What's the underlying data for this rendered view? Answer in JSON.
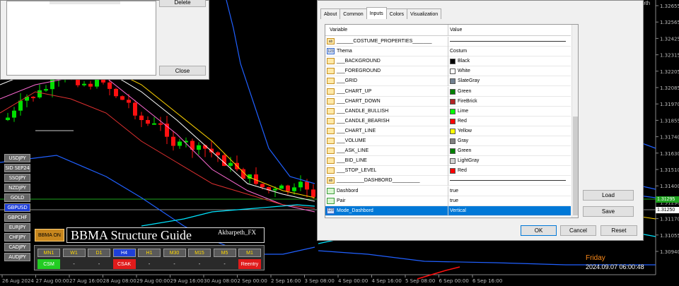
{
  "left_dialog": {
    "delete_label": "Delete",
    "close_label": "Close"
  },
  "price_axis": {
    "labels": [
      "1.32655",
      "1.32565",
      "1.32425",
      "1.32315",
      "1.32205",
      "1.32085",
      "1.31970",
      "1.31855",
      "1.31740",
      "1.31630",
      "1.31510",
      "1.31400",
      "1.31290",
      "1.31170",
      "1.31055",
      "1.30940"
    ],
    "current_green": "1.31295",
    "current_white": "1.31250"
  },
  "time_axis": {
    "labels": [
      "26 Aug 2024",
      "27 Aug 00:00",
      "27 Aug 16:00",
      "28 Aug 08:00",
      "29 Aug 00:00",
      "29 Aug 16:00",
      "30 Aug 08:00",
      "2 Sep 00:00",
      "2 Sep 16:00",
      "3 Sep 08:00",
      "4 Sep 00:00",
      "4 Sep 16:00",
      "5 Sep 08:00",
      "6 Sep 00:00",
      "6 Sep 16:00"
    ]
  },
  "symbols": [
    "USDJPY",
    "SID SEP24",
    "SSOJPY",
    "NZDJPY",
    "GOLD",
    "GBPUSD",
    "GBPCHF",
    "EURJPY",
    "CHFJPY",
    "CADJPY",
    "AUDJPY"
  ],
  "active_symbol": "GBPUSD",
  "dashboard": {
    "bbma_on": "BBMA ON",
    "title": "BBMA Structure Guide",
    "author": "Akbarpeth_FX",
    "timeframes": [
      "MN1",
      "W1",
      "D1",
      "H4",
      "H1",
      "M30",
      "M15",
      "M5",
      "M1"
    ],
    "active_tf": "H4",
    "signals": [
      {
        "text": "CSM",
        "color": "#22cc22"
      },
      {
        "text": "-",
        "color": ""
      },
      {
        "text": "-",
        "color": ""
      },
      {
        "text": "CSAK",
        "color": "#e01b1b"
      },
      {
        "text": "-",
        "color": ""
      },
      {
        "text": "-",
        "color": ""
      },
      {
        "text": "-",
        "color": ""
      },
      {
        "text": "-",
        "color": ""
      },
      {
        "text": "Reentry",
        "color": "#e01b1b"
      }
    ]
  },
  "clock": {
    "day": "Friday",
    "datetime": "2024.09.07 06:00:48"
  },
  "corner_text": "eth",
  "props_dialog": {
    "tabs": [
      "About",
      "Common",
      "Inputs",
      "Colors",
      "Visualization"
    ],
    "active_tab": "Inputs",
    "col_variable": "Variable",
    "col_value": "Value",
    "rows": [
      {
        "icon": "ab",
        "name": "______COSTUME_PROPERTIES_______",
        "value": "",
        "kind": "line"
      },
      {
        "icon": "123",
        "name": "Thema",
        "value": "Costum",
        "kind": "text"
      },
      {
        "icon": "clr",
        "name": "___BACKGROUND",
        "value": "Black",
        "swatch": "#000000"
      },
      {
        "icon": "clr",
        "name": "___FOREGROUND",
        "value": "White",
        "swatch": "#ffffff"
      },
      {
        "icon": "clr",
        "name": "___GRID",
        "value": "SlateGray",
        "swatch": "#708090"
      },
      {
        "icon": "clr",
        "name": "___CHART_UP",
        "value": "Green",
        "swatch": "#008000"
      },
      {
        "icon": "clr",
        "name": "___CHART_DOWN",
        "value": "FireBrick",
        "swatch": "#b22222"
      },
      {
        "icon": "clr",
        "name": "___CANDLE_BULLISH",
        "value": "Lime",
        "swatch": "#00ff00"
      },
      {
        "icon": "clr",
        "name": "___CANDLE_BEARISH",
        "value": "Red",
        "swatch": "#ff0000"
      },
      {
        "icon": "clr",
        "name": "___CHART_LINE",
        "value": "Yellow",
        "swatch": "#ffff00"
      },
      {
        "icon": "clr",
        "name": "___VOLUME",
        "value": "Gray",
        "swatch": "#808080"
      },
      {
        "icon": "clr",
        "name": "___ASK_LINE",
        "value": "Green",
        "swatch": "#008000"
      },
      {
        "icon": "clr",
        "name": "___BID_LINE",
        "value": "LightGray",
        "swatch": "#d3d3d3"
      },
      {
        "icon": "clr",
        "name": "___STOP_LEVEL",
        "value": "Red",
        "swatch": "#ff0000"
      },
      {
        "icon": "ab",
        "name": "__________DASHBORD__________",
        "value": "",
        "kind": "line"
      },
      {
        "icon": "bool",
        "name": "Dashbord",
        "value": "true",
        "kind": "text"
      },
      {
        "icon": "bool",
        "name": "Pair",
        "value": "true",
        "kind": "text"
      },
      {
        "icon": "123",
        "name": "Mode_Dashbord",
        "value": "Vertical",
        "kind": "text",
        "selected": true
      }
    ],
    "load_label": "Load",
    "save_label": "Save",
    "ok_label": "OK",
    "cancel_label": "Cancel",
    "reset_label": "Reset"
  }
}
